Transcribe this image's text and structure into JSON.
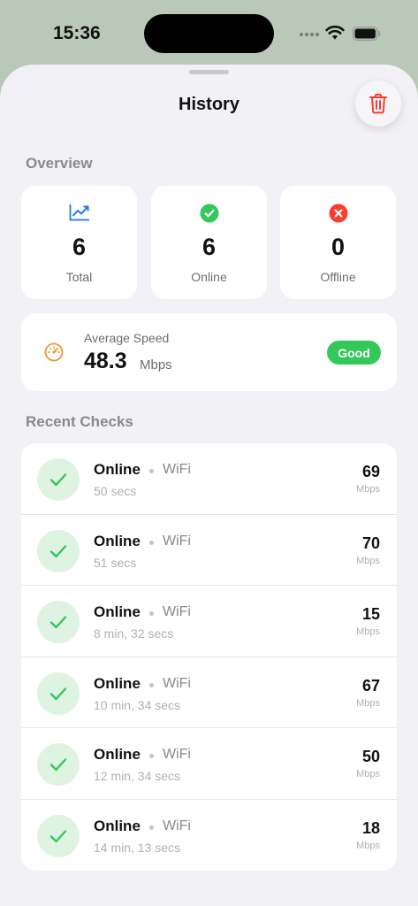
{
  "status_bar": {
    "time": "15:36",
    "icons": [
      "cellular-dots-icon",
      "wifi-icon",
      "battery-icon"
    ]
  },
  "header": {
    "title": "History",
    "trash_icon": "trash-icon"
  },
  "overview": {
    "heading": "Overview",
    "cards": [
      {
        "icon": "chart-line-icon",
        "value": "6",
        "label": "Total"
      },
      {
        "icon": "checkmark-circle-icon",
        "value": "6",
        "label": "Online"
      },
      {
        "icon": "xmark-circle-icon",
        "value": "0",
        "label": "Offline"
      }
    ]
  },
  "average_speed": {
    "label": "Average Speed",
    "value": "48.3",
    "unit": "Mbps",
    "badge": "Good",
    "icon": "speedometer-icon"
  },
  "recent": {
    "heading": "Recent Checks",
    "items": [
      {
        "status": "Online",
        "connection": "WiFi",
        "time": "50 secs",
        "speed": "69",
        "unit": "Mbps"
      },
      {
        "status": "Online",
        "connection": "WiFi",
        "time": "51 secs",
        "speed": "70",
        "unit": "Mbps"
      },
      {
        "status": "Online",
        "connection": "WiFi",
        "time": "8 min, 32 secs",
        "speed": "15",
        "unit": "Mbps"
      },
      {
        "status": "Online",
        "connection": "WiFi",
        "time": "10 min, 34 secs",
        "speed": "67",
        "unit": "Mbps"
      },
      {
        "status": "Online",
        "connection": "WiFi",
        "time": "12 min, 34 secs",
        "speed": "50",
        "unit": "Mbps"
      },
      {
        "status": "Online",
        "connection": "WiFi",
        "time": "14 min, 13 secs",
        "speed": "18",
        "unit": "Mbps"
      }
    ]
  },
  "colors": {
    "accent_blue": "#1e7be0",
    "online_green": "#34c759",
    "offline_red": "#ff3b30",
    "speed_orange": "#f0962d",
    "background_tint": "#b9c8b8"
  }
}
